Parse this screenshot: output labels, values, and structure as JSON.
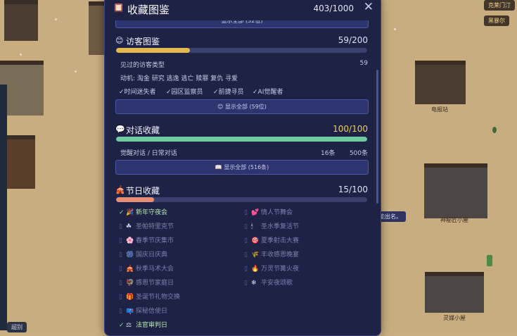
{
  "background": {
    "tags": [
      "克莱门汀",
      "黑暴尔"
    ],
    "buildings": [
      "电报站",
      "神秘匠小屋",
      "灵媒小屋"
    ],
    "bubble": "能出名。",
    "left_tag": "超别"
  },
  "modal": {
    "title": "收藏图鉴",
    "total": "403/1000",
    "close": "✕",
    "top_button": "显示全部 (32位)",
    "visitors": {
      "icon": "😊",
      "title": "访客图鉴",
      "count": "59/200",
      "progress": 0.295,
      "types_label": "见过的访客类型",
      "types_count": "59",
      "motives": "动机: 淘金 研究 逃逸 逃亡 赎罪 复仇 寻爱",
      "badges": [
        "✓时间迷失者",
        "✓园区监察员",
        "✓前捷寻员",
        "✓AI觉醒者"
      ],
      "button": "😊 显示全部 (59位)"
    },
    "dialogues": {
      "icon": "💬",
      "title": "对话收藏",
      "count": "100/100",
      "progress": 1.0,
      "row_label": "觉醒对话 / 日常对话",
      "row_a": "16条",
      "row_b": "500条",
      "button": "📖 显示全部 (516条)"
    },
    "festivals": {
      "icon": "🎪",
      "title": "节日收藏",
      "count": "15/100",
      "progress": 0.15,
      "left": [
        {
          "icon": "🎉",
          "label": "新年守夜会",
          "done": true
        },
        {
          "icon": "☘",
          "label": "圣帕特里克节",
          "done": false
        },
        {
          "icon": "🌸",
          "label": "春季节庆集市",
          "done": false
        },
        {
          "icon": "🎆",
          "label": "国庆日庆典",
          "done": false
        },
        {
          "icon": "🎪",
          "label": "秋季马术大会",
          "done": false
        },
        {
          "icon": "🦃",
          "label": "感恩节家庭日",
          "done": false
        },
        {
          "icon": "🎁",
          "label": "圣诞节礼物交换",
          "done": false
        },
        {
          "icon": "📪",
          "label": "探秘信使日",
          "done": false
        },
        {
          "icon": "⚖",
          "label": "法官审判日",
          "done": true
        }
      ],
      "right": [
        {
          "icon": "💕",
          "label": "情人节舞会",
          "done": false
        },
        {
          "icon": "🕯",
          "label": "圣水季复活节",
          "done": false
        },
        {
          "icon": "🎯",
          "label": "夏季射击大赛",
          "done": false
        },
        {
          "icon": "🌾",
          "label": "丰收感恩晚宴",
          "done": false
        },
        {
          "icon": "🔥",
          "label": "万灵节篝火夜",
          "done": false
        },
        {
          "icon": "❄",
          "label": "平安夜颂歌",
          "done": false
        }
      ]
    }
  },
  "colors": {
    "visitor_bar": "#e3b94e",
    "dialogue_bar": "#6fcaa0",
    "festival_bar": "#e48f75"
  }
}
